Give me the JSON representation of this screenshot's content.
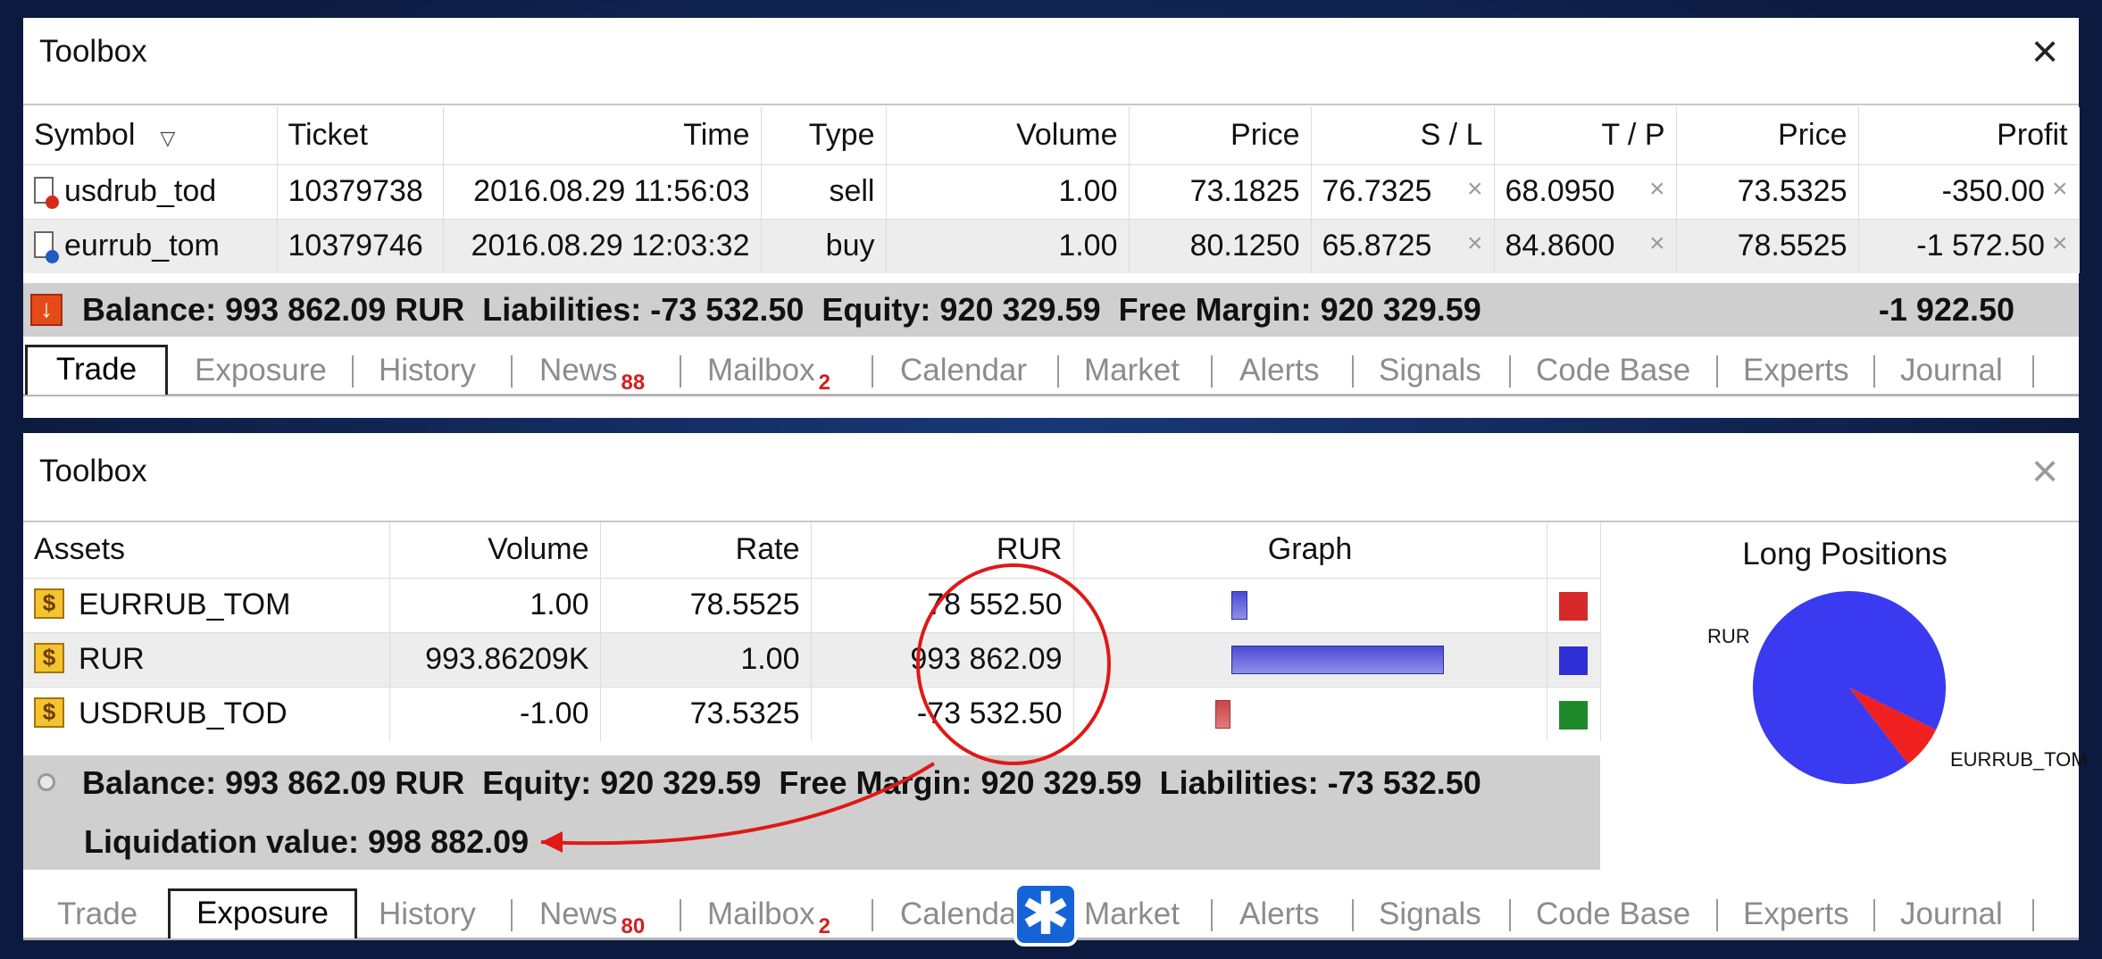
{
  "toolbox_top": {
    "title": "Toolbox",
    "close_icon": "close-icon",
    "columns": [
      "Symbol",
      "Ticket",
      "Time",
      "Type",
      "Volume",
      "Price",
      "S / L",
      "T / P",
      "Price",
      "Profit"
    ],
    "rows": [
      {
        "symbol": "usdrub_tod",
        "ticket": "10379738",
        "time": "2016.08.29 11:56:03",
        "type": "sell",
        "volume": "1.00",
        "price": "73.1825",
        "sl": "76.7325",
        "tp": "68.0950",
        "price2": "73.5325",
        "profit": "-350.00"
      },
      {
        "symbol": "eurrub_tom",
        "ticket": "10379746",
        "time": "2016.08.29 12:03:32",
        "type": "buy",
        "volume": "1.00",
        "price": "80.1250",
        "sl": "65.8725",
        "tp": "84.8600",
        "price2": "78.5525",
        "profit": "-1 572.50"
      }
    ],
    "x_glyph": "×",
    "summary": "Balance: 993 862.09 RUR  Liabilities: -73 532.50  Equity: 920 329.59  Free Margin: 920 329.59",
    "summary_total": "-1 922.50",
    "tabs": [
      {
        "label": "Trade",
        "badge": ""
      },
      {
        "label": "Exposure",
        "badge": ""
      },
      {
        "label": "History",
        "badge": ""
      },
      {
        "label": "News",
        "badge": "88"
      },
      {
        "label": "Mailbox",
        "badge": "2"
      },
      {
        "label": "Calendar",
        "badge": ""
      },
      {
        "label": "Market",
        "badge": ""
      },
      {
        "label": "Alerts",
        "badge": ""
      },
      {
        "label": "Signals",
        "badge": ""
      },
      {
        "label": "Code Base",
        "badge": ""
      },
      {
        "label": "Experts",
        "badge": ""
      },
      {
        "label": "Journal",
        "badge": ""
      }
    ],
    "active_tab": "Trade"
  },
  "toolbox_bottom": {
    "title": "Toolbox",
    "columns": [
      "Assets",
      "Volume",
      "Rate",
      "RUR",
      "Graph"
    ],
    "rows": [
      {
        "asset": "EURRUB_TOM",
        "volume": "1.00",
        "rate": "78.5525",
        "rur": "78 552.50",
        "graph_value": 78552.5,
        "color": "#d62a2a"
      },
      {
        "asset": "RUR",
        "volume": "993.86209K",
        "rate": "1.00",
        "rur": "993 862.09",
        "graph_value": 993862.09,
        "color": "#2f2fd6"
      },
      {
        "asset": "USDRUB_TOD",
        "volume": "-1.00",
        "rate": "73.5325",
        "rur": "-73 532.50",
        "graph_value": -73532.5,
        "color": "#1f8a2a"
      }
    ],
    "coin_glyph": "$",
    "summary_line1": "Balance: 993 862.09 RUR  Equity: 920 329.59  Free Margin: 920 329.59  Liabilities: -73 532.50",
    "summary_line2": "Liquidation value: 998 882.09",
    "pie": {
      "title": "Long Positions",
      "slices": [
        {
          "label": "RUR",
          "value": 993862.09,
          "color": "#3a3af0"
        },
        {
          "label": "EURRUB_TOM",
          "value": 78552.5,
          "color": "#f02020"
        }
      ]
    },
    "tabs": [
      {
        "label": "Trade",
        "badge": ""
      },
      {
        "label": "Exposure",
        "badge": ""
      },
      {
        "label": "History",
        "badge": ""
      },
      {
        "label": "News",
        "badge": "80"
      },
      {
        "label": "Mailbox",
        "badge": "2"
      },
      {
        "label": "Calendar",
        "badge": ""
      },
      {
        "label": "Market",
        "badge": ""
      },
      {
        "label": "Alerts",
        "badge": ""
      },
      {
        "label": "Signals",
        "badge": ""
      },
      {
        "label": "Code Base",
        "badge": ""
      },
      {
        "label": "Experts",
        "badge": ""
      },
      {
        "label": "Journal",
        "badge": ""
      }
    ],
    "active_tab": "Exposure"
  },
  "annotation": {
    "color": "#e01818"
  },
  "logo_icon": "asterisk-logo-icon"
}
